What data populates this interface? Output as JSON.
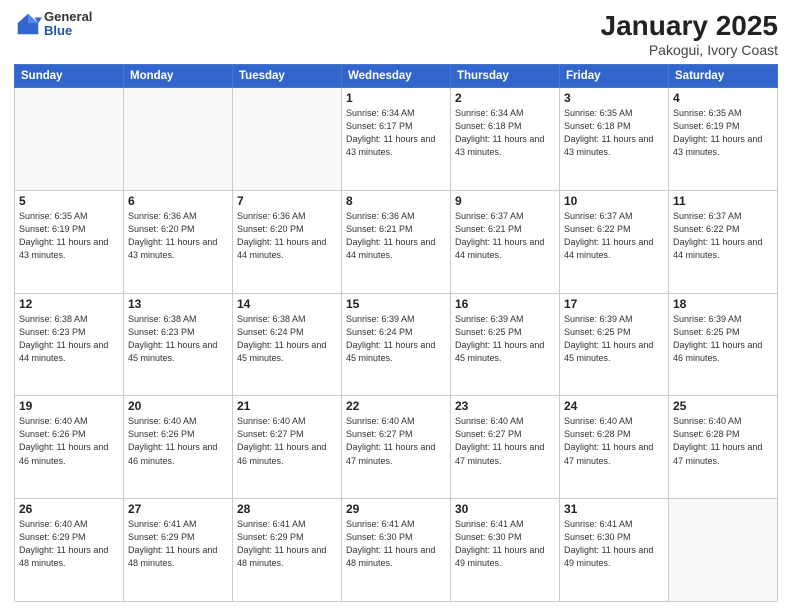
{
  "header": {
    "logo_general": "General",
    "logo_blue": "Blue",
    "title": "January 2025",
    "subtitle": "Pakogui, Ivory Coast"
  },
  "days_of_week": [
    "Sunday",
    "Monday",
    "Tuesday",
    "Wednesday",
    "Thursday",
    "Friday",
    "Saturday"
  ],
  "weeks": [
    [
      {
        "day": "",
        "info": ""
      },
      {
        "day": "",
        "info": ""
      },
      {
        "day": "",
        "info": ""
      },
      {
        "day": "1",
        "info": "Sunrise: 6:34 AM\nSunset: 6:17 PM\nDaylight: 11 hours and 43 minutes."
      },
      {
        "day": "2",
        "info": "Sunrise: 6:34 AM\nSunset: 6:18 PM\nDaylight: 11 hours and 43 minutes."
      },
      {
        "day": "3",
        "info": "Sunrise: 6:35 AM\nSunset: 6:18 PM\nDaylight: 11 hours and 43 minutes."
      },
      {
        "day": "4",
        "info": "Sunrise: 6:35 AM\nSunset: 6:19 PM\nDaylight: 11 hours and 43 minutes."
      }
    ],
    [
      {
        "day": "5",
        "info": "Sunrise: 6:35 AM\nSunset: 6:19 PM\nDaylight: 11 hours and 43 minutes."
      },
      {
        "day": "6",
        "info": "Sunrise: 6:36 AM\nSunset: 6:20 PM\nDaylight: 11 hours and 43 minutes."
      },
      {
        "day": "7",
        "info": "Sunrise: 6:36 AM\nSunset: 6:20 PM\nDaylight: 11 hours and 44 minutes."
      },
      {
        "day": "8",
        "info": "Sunrise: 6:36 AM\nSunset: 6:21 PM\nDaylight: 11 hours and 44 minutes."
      },
      {
        "day": "9",
        "info": "Sunrise: 6:37 AM\nSunset: 6:21 PM\nDaylight: 11 hours and 44 minutes."
      },
      {
        "day": "10",
        "info": "Sunrise: 6:37 AM\nSunset: 6:22 PM\nDaylight: 11 hours and 44 minutes."
      },
      {
        "day": "11",
        "info": "Sunrise: 6:37 AM\nSunset: 6:22 PM\nDaylight: 11 hours and 44 minutes."
      }
    ],
    [
      {
        "day": "12",
        "info": "Sunrise: 6:38 AM\nSunset: 6:23 PM\nDaylight: 11 hours and 44 minutes."
      },
      {
        "day": "13",
        "info": "Sunrise: 6:38 AM\nSunset: 6:23 PM\nDaylight: 11 hours and 45 minutes."
      },
      {
        "day": "14",
        "info": "Sunrise: 6:38 AM\nSunset: 6:24 PM\nDaylight: 11 hours and 45 minutes."
      },
      {
        "day": "15",
        "info": "Sunrise: 6:39 AM\nSunset: 6:24 PM\nDaylight: 11 hours and 45 minutes."
      },
      {
        "day": "16",
        "info": "Sunrise: 6:39 AM\nSunset: 6:25 PM\nDaylight: 11 hours and 45 minutes."
      },
      {
        "day": "17",
        "info": "Sunrise: 6:39 AM\nSunset: 6:25 PM\nDaylight: 11 hours and 45 minutes."
      },
      {
        "day": "18",
        "info": "Sunrise: 6:39 AM\nSunset: 6:25 PM\nDaylight: 11 hours and 46 minutes."
      }
    ],
    [
      {
        "day": "19",
        "info": "Sunrise: 6:40 AM\nSunset: 6:26 PM\nDaylight: 11 hours and 46 minutes."
      },
      {
        "day": "20",
        "info": "Sunrise: 6:40 AM\nSunset: 6:26 PM\nDaylight: 11 hours and 46 minutes."
      },
      {
        "day": "21",
        "info": "Sunrise: 6:40 AM\nSunset: 6:27 PM\nDaylight: 11 hours and 46 minutes."
      },
      {
        "day": "22",
        "info": "Sunrise: 6:40 AM\nSunset: 6:27 PM\nDaylight: 11 hours and 47 minutes."
      },
      {
        "day": "23",
        "info": "Sunrise: 6:40 AM\nSunset: 6:27 PM\nDaylight: 11 hours and 47 minutes."
      },
      {
        "day": "24",
        "info": "Sunrise: 6:40 AM\nSunset: 6:28 PM\nDaylight: 11 hours and 47 minutes."
      },
      {
        "day": "25",
        "info": "Sunrise: 6:40 AM\nSunset: 6:28 PM\nDaylight: 11 hours and 47 minutes."
      }
    ],
    [
      {
        "day": "26",
        "info": "Sunrise: 6:40 AM\nSunset: 6:29 PM\nDaylight: 11 hours and 48 minutes."
      },
      {
        "day": "27",
        "info": "Sunrise: 6:41 AM\nSunset: 6:29 PM\nDaylight: 11 hours and 48 minutes."
      },
      {
        "day": "28",
        "info": "Sunrise: 6:41 AM\nSunset: 6:29 PM\nDaylight: 11 hours and 48 minutes."
      },
      {
        "day": "29",
        "info": "Sunrise: 6:41 AM\nSunset: 6:30 PM\nDaylight: 11 hours and 48 minutes."
      },
      {
        "day": "30",
        "info": "Sunrise: 6:41 AM\nSunset: 6:30 PM\nDaylight: 11 hours and 49 minutes."
      },
      {
        "day": "31",
        "info": "Sunrise: 6:41 AM\nSunset: 6:30 PM\nDaylight: 11 hours and 49 minutes."
      },
      {
        "day": "",
        "info": ""
      }
    ]
  ]
}
